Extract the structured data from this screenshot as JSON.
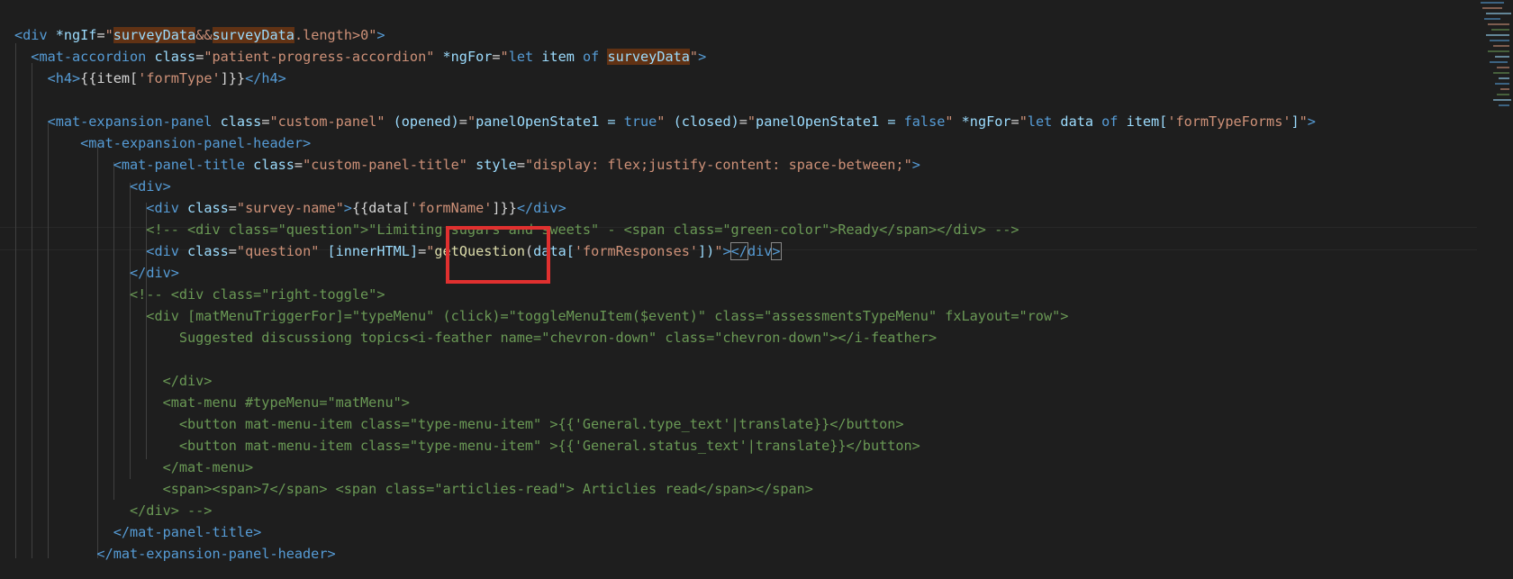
{
  "editor": {
    "lines": [
      [
        {
          "t": "<",
          "c": "tag"
        },
        {
          "t": "div",
          "c": "tag"
        },
        {
          "t": " *ngIf",
          "c": "attr"
        },
        {
          "t": "=",
          "c": "plain"
        },
        {
          "t": "\"",
          "c": "str"
        },
        {
          "t": "surveyData",
          "c": "attr hl"
        },
        {
          "t": "&&",
          "c": "str"
        },
        {
          "t": "surveyData",
          "c": "attr hl"
        },
        {
          "t": ".length>0",
          "c": "str"
        },
        {
          "t": "\"",
          "c": "str"
        },
        {
          "t": ">",
          "c": "tag"
        }
      ],
      [
        {
          "t": "  <",
          "c": "tag"
        },
        {
          "t": "mat-accordion",
          "c": "tag"
        },
        {
          "t": " class",
          "c": "attr"
        },
        {
          "t": "=",
          "c": "plain"
        },
        {
          "t": "\"patient-progress-accordion\"",
          "c": "str"
        },
        {
          "t": " *ngFor",
          "c": "attr"
        },
        {
          "t": "=",
          "c": "plain"
        },
        {
          "t": "\"",
          "c": "str"
        },
        {
          "t": "let",
          "c": "tag"
        },
        {
          "t": " item ",
          "c": "attr"
        },
        {
          "t": "of",
          "c": "tag"
        },
        {
          "t": " ",
          "c": "plain"
        },
        {
          "t": "surveyData",
          "c": "attr hl"
        },
        {
          "t": "\"",
          "c": "str"
        },
        {
          "t": ">",
          "c": "tag"
        }
      ],
      [
        {
          "t": "    <",
          "c": "tag"
        },
        {
          "t": "h4",
          "c": "tag"
        },
        {
          "t": ">",
          "c": "tag"
        },
        {
          "t": "{{item[",
          "c": "plain"
        },
        {
          "t": "'formType'",
          "c": "str"
        },
        {
          "t": "]}}",
          "c": "plain"
        },
        {
          "t": "</",
          "c": "tag"
        },
        {
          "t": "h4",
          "c": "tag"
        },
        {
          "t": ">",
          "c": "tag"
        }
      ],
      [],
      [
        {
          "t": "    <",
          "c": "tag"
        },
        {
          "t": "mat-expansion-panel",
          "c": "tag"
        },
        {
          "t": " class",
          "c": "attr"
        },
        {
          "t": "=",
          "c": "plain"
        },
        {
          "t": "\"custom-panel\"",
          "c": "str"
        },
        {
          "t": " (opened)",
          "c": "attr"
        },
        {
          "t": "=",
          "c": "plain"
        },
        {
          "t": "\"",
          "c": "str"
        },
        {
          "t": "panelOpenState1 = ",
          "c": "attr"
        },
        {
          "t": "true",
          "c": "tag"
        },
        {
          "t": "\"",
          "c": "str"
        },
        {
          "t": " (closed)",
          "c": "attr"
        },
        {
          "t": "=",
          "c": "plain"
        },
        {
          "t": "\"",
          "c": "str"
        },
        {
          "t": "panelOpenState1 = ",
          "c": "attr"
        },
        {
          "t": "false",
          "c": "tag"
        },
        {
          "t": "\"",
          "c": "str"
        },
        {
          "t": " *ngFor",
          "c": "attr"
        },
        {
          "t": "=",
          "c": "plain"
        },
        {
          "t": "\"",
          "c": "str"
        },
        {
          "t": "let",
          "c": "tag"
        },
        {
          "t": " data ",
          "c": "attr"
        },
        {
          "t": "of",
          "c": "tag"
        },
        {
          "t": " item[",
          "c": "attr"
        },
        {
          "t": "'formTypeForms'",
          "c": "str"
        },
        {
          "t": "]",
          "c": "attr"
        },
        {
          "t": "\"",
          "c": "str"
        },
        {
          "t": ">",
          "c": "tag"
        }
      ],
      [
        {
          "t": "        <",
          "c": "tag"
        },
        {
          "t": "mat-expansion-panel-header",
          "c": "tag"
        },
        {
          "t": ">",
          "c": "tag"
        }
      ],
      [
        {
          "t": "            <",
          "c": "tag"
        },
        {
          "t": "mat-panel-title",
          "c": "tag"
        },
        {
          "t": " class",
          "c": "attr"
        },
        {
          "t": "=",
          "c": "plain"
        },
        {
          "t": "\"custom-panel-title\"",
          "c": "str"
        },
        {
          "t": " style",
          "c": "attr"
        },
        {
          "t": "=",
          "c": "plain"
        },
        {
          "t": "\"display: flex;justify-content: space-between;\"",
          "c": "str"
        },
        {
          "t": ">",
          "c": "tag"
        }
      ],
      [
        {
          "t": "              <",
          "c": "tag"
        },
        {
          "t": "div",
          "c": "tag"
        },
        {
          "t": ">",
          "c": "tag"
        }
      ],
      [
        {
          "t": "                <",
          "c": "tag"
        },
        {
          "t": "div",
          "c": "tag"
        },
        {
          "t": " class",
          "c": "attr"
        },
        {
          "t": "=",
          "c": "plain"
        },
        {
          "t": "\"survey-name\"",
          "c": "str"
        },
        {
          "t": ">",
          "c": "tag"
        },
        {
          "t": "{{data[",
          "c": "plain"
        },
        {
          "t": "'formName'",
          "c": "str"
        },
        {
          "t": "]}}",
          "c": "plain"
        },
        {
          "t": "</",
          "c": "tag"
        },
        {
          "t": "div",
          "c": "tag"
        },
        {
          "t": ">",
          "c": "tag"
        }
      ],
      [
        {
          "t": "                <!-- <div class=\"question\">\"Limiting sugars and sweets\" - <span class=\"green-color\">Ready</span></div> -->",
          "c": "cmt"
        }
      ],
      [
        {
          "t": "                <",
          "c": "tag"
        },
        {
          "t": "div",
          "c": "tag"
        },
        {
          "t": " class",
          "c": "attr"
        },
        {
          "t": "=",
          "c": "plain"
        },
        {
          "t": "\"question\"",
          "c": "str"
        },
        {
          "t": " [innerHTML]",
          "c": "attr"
        },
        {
          "t": "=",
          "c": "plain"
        },
        {
          "t": "\"",
          "c": "str"
        },
        {
          "t": "getQuestion",
          "c": "func"
        },
        {
          "t": "(",
          "c": "plain"
        },
        {
          "t": "data[",
          "c": "attr"
        },
        {
          "t": "'formResponses'",
          "c": "str"
        },
        {
          "t": "])",
          "c": "attr"
        },
        {
          "t": "\"",
          "c": "str"
        },
        {
          "t": ">",
          "c": "tag"
        },
        {
          "t": "</",
          "c": "tag bracket-box"
        },
        {
          "t": "div",
          "c": "tag"
        },
        {
          "t": ">",
          "c": "tag bracket-box"
        }
      ],
      [
        {
          "t": "              </",
          "c": "tag"
        },
        {
          "t": "div",
          "c": "tag"
        },
        {
          "t": ">",
          "c": "tag"
        }
      ],
      [
        {
          "t": "              <!-- <div class=\"right-toggle\">",
          "c": "cmt"
        }
      ],
      [
        {
          "t": "                <div [matMenuTriggerFor]=\"typeMenu\" (click)=\"toggleMenuItem($event)\" class=\"assessmentsTypeMenu\" fxLayout=\"row\">",
          "c": "cmt"
        }
      ],
      [
        {
          "t": "                    Suggested discussiong topics<i-feather name=\"chevron-down\" class=\"chevron-down\"></i-feather>",
          "c": "cmt"
        }
      ],
      [],
      [
        {
          "t": "                  </div>",
          "c": "cmt"
        }
      ],
      [
        {
          "t": "                  <mat-menu #typeMenu=\"matMenu\">",
          "c": "cmt"
        }
      ],
      [
        {
          "t": "                    <button mat-menu-item class=\"type-menu-item\" >{{'General.type_text'|translate}}</button>",
          "c": "cmt"
        }
      ],
      [
        {
          "t": "                    <button mat-menu-item class=\"type-menu-item\" >{{'General.status_text'|translate}}</button>",
          "c": "cmt"
        }
      ],
      [
        {
          "t": "                  </mat-menu>",
          "c": "cmt"
        }
      ],
      [
        {
          "t": "                  <span><span>7</span> <span class=\"articlies-read\"> Articlies read</span></span>",
          "c": "cmt"
        }
      ],
      [
        {
          "t": "              </div> -->",
          "c": "cmt"
        }
      ],
      [
        {
          "t": "            </",
          "c": "tag"
        },
        {
          "t": "mat-panel-title",
          "c": "tag"
        },
        {
          "t": ">",
          "c": "tag"
        }
      ],
      [
        {
          "t": "          </",
          "c": "tag"
        },
        {
          "t": "mat-expansion-panel-header",
          "c": "tag"
        },
        {
          "t": ">",
          "c": "tag"
        }
      ],
      []
    ],
    "colors": {
      "background": "#1e1e1e",
      "tag": "#569cd6",
      "attribute": "#9cdcfe",
      "string": "#ce9178",
      "comment": "#6a9955",
      "function": "#dcdcaa",
      "highlight_box": "#e0302f"
    }
  }
}
